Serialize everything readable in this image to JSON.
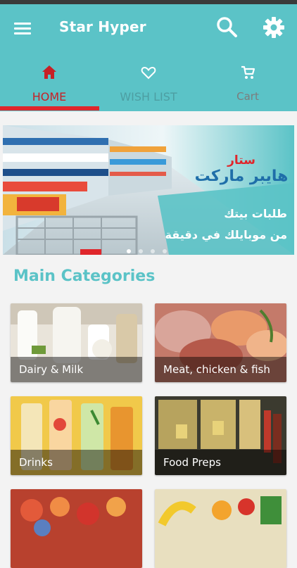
{
  "app": {
    "title": "Star Hyper"
  },
  "header": {
    "icons": [
      "menu-icon",
      "search-icon",
      "settings-gear-icon"
    ]
  },
  "tabs": [
    {
      "label": "HOME",
      "icon": "home-icon",
      "active": true
    },
    {
      "label": "WISH LIST",
      "icon": "heart-icon",
      "active": false
    },
    {
      "label": "Cart",
      "icon": "cart-icon",
      "active": false
    }
  ],
  "banner": {
    "brand_line1": "ستار",
    "brand_line2": "هايبر ماركت",
    "slogan_line1": "طلبات بيتك",
    "slogan_line2": "من موبايلك في دقيقة",
    "slide_count": 4,
    "current_slide": 1
  },
  "categories": {
    "title": "Main Categories",
    "items": [
      {
        "label": "Dairy & Milk"
      },
      {
        "label": "Meat, chicken & fish"
      },
      {
        "label": "Drinks"
      },
      {
        "label": "Food Preps"
      },
      {
        "label": ""
      },
      {
        "label": ""
      }
    ]
  },
  "colors": {
    "primary": "#5bc3c7",
    "accent": "#e0262b",
    "background": "#f3f3f3"
  }
}
